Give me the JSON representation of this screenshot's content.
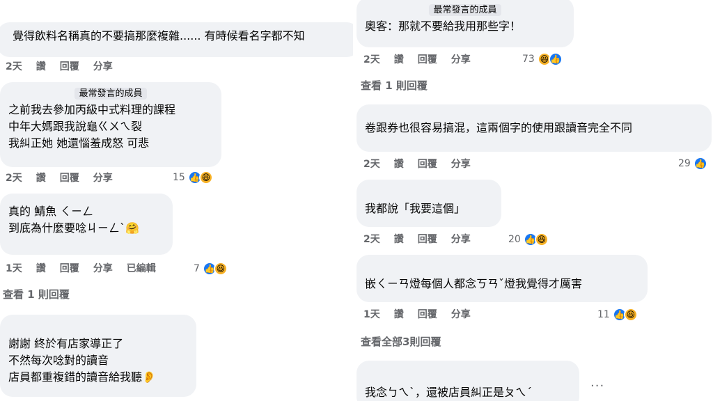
{
  "left": {
    "c1": {
      "text": "覺得飲料名稱真的不要搞那麼複雜...... 有時候看名字都不知",
      "time": "2天",
      "like": "讚",
      "reply": "回覆",
      "share": "分享"
    },
    "c2": {
      "badge": "最常發言的成員",
      "lines": "之前我去參加丙級中式料理的課程\n中年大媽跟我說龜ㄍㄨㄟ裂\n我糾正她 她還惱羞成怒 可悲",
      "time": "2天",
      "like": "讚",
      "reply": "回覆",
      "share": "分享",
      "count": "15"
    },
    "c3": {
      "lines": "真的 鯖魚 ㄑㄧㄥ\n到底為什麼要唸ㄐㄧㄥˋ🤗",
      "time": "1天",
      "like": "讚",
      "reply": "回覆",
      "share": "分享",
      "edited": "已編輯",
      "count": "7"
    },
    "view1": "查看 1 則回覆",
    "c4": {
      "lines": "謝謝 終於有店家導正了\n不然每次唸對的讀音\n店員都重複錯的讀音給我聽👂"
    }
  },
  "right": {
    "c1": {
      "badge": "最常發言的成員",
      "text": "奧客：那就不要給我用那些字！",
      "time": "2天",
      "like": "讚",
      "reply": "回覆",
      "share": "分享",
      "count": "73"
    },
    "view1": "查看 1 則回覆",
    "c2": {
      "text": "卷跟券也很容易搞混，這兩個字的使用跟讀音完全不同",
      "time": "2天",
      "like": "讚",
      "reply": "回覆",
      "share": "分享",
      "count": "29"
    },
    "c3": {
      "text": "我都說「我要這個」",
      "time": "2天",
      "like": "讚",
      "reply": "回覆",
      "share": "分享",
      "count": "20"
    },
    "c4": {
      "text": "嵌ㄑㄧㄢ燈每個人都念ㄎㄢˇ燈我覺得才厲害",
      "time": "1天",
      "like": "讚",
      "reply": "回覆",
      "share": "分享",
      "count": "11"
    },
    "view2": "查看全部3則回覆",
    "c5": {
      "text": "我念ㄅㄟˋ，還被店員糾正是ㄆㄟˊ"
    },
    "more": "···"
  },
  "icons": {
    "like": "thumbs-up-icon",
    "haha": "laughing-face-icon"
  },
  "colors": {
    "bubble": "#f0f2f5",
    "meta": "#65676b",
    "like": "#1877f2",
    "haha": "#f7b125"
  }
}
